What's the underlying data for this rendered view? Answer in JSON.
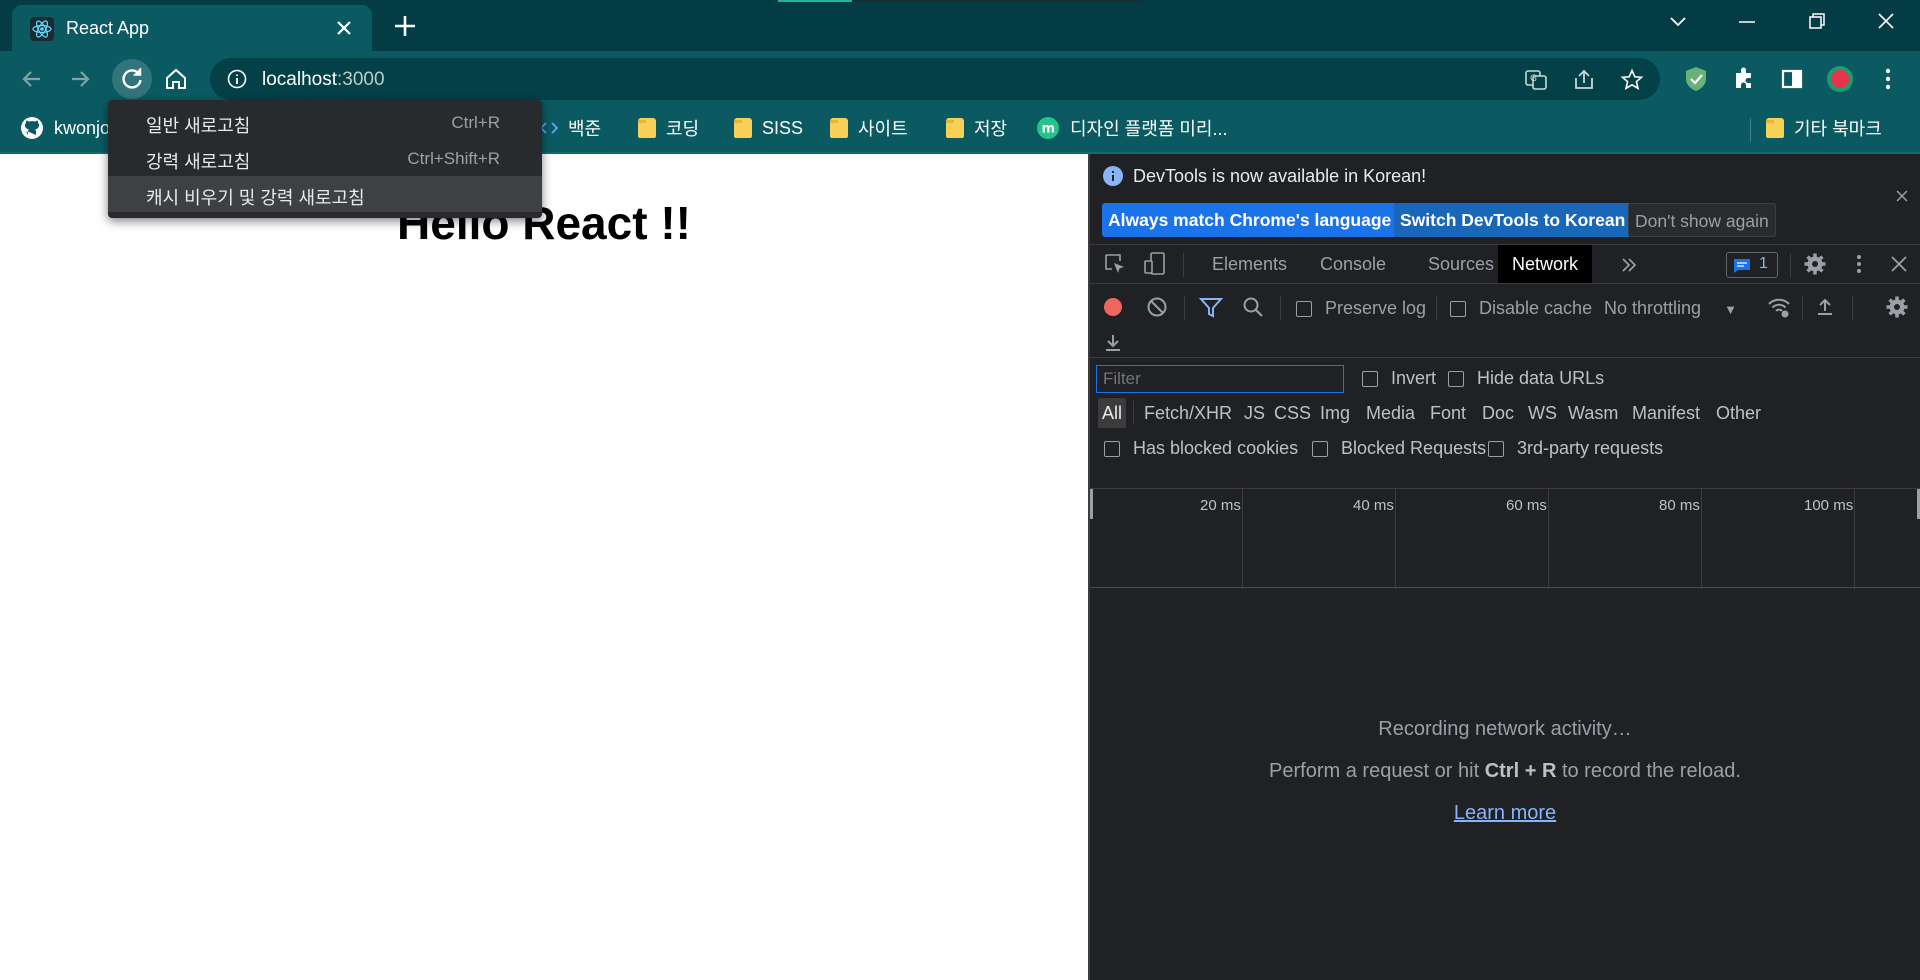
{
  "browser": {
    "tab_title": "React App",
    "url_host": "localhost",
    "url_port": ":3000"
  },
  "bookmarks": [
    {
      "label": "kwonjo",
      "icon": "github-icon"
    },
    {
      "label": "백준",
      "icon": "code-icon"
    },
    {
      "label": "코딩",
      "icon": "folder-icon"
    },
    {
      "label": "SISS",
      "icon": "folder-icon"
    },
    {
      "label": "사이트",
      "icon": "folder-icon"
    },
    {
      "label": "저장",
      "icon": "folder-icon"
    },
    {
      "label": "디자인 플랫폼 미리...",
      "icon": "miro-icon"
    },
    {
      "label": "기타 북마크",
      "icon": "folder-icon"
    }
  ],
  "context_menu": {
    "items": [
      {
        "label": "일반 새로고침",
        "shortcut": "Ctrl+R"
      },
      {
        "label": "강력 새로고침",
        "shortcut": "Ctrl+Shift+R"
      },
      {
        "label": "캐시 비우기 및 강력 새로고침",
        "shortcut": ""
      }
    ]
  },
  "page": {
    "heading": "Hello React !!"
  },
  "devtools": {
    "infobar": {
      "message": "DevTools is now available in Korean!",
      "btn_match": "Always match Chrome's language",
      "btn_switch": "Switch DevTools to Korean",
      "btn_dismiss": "Don't show again"
    },
    "tabs": [
      "Elements",
      "Console",
      "Sources",
      "Network"
    ],
    "active_tab": "Network",
    "issues_count": "1",
    "network": {
      "preserve_log": "Preserve log",
      "disable_cache": "Disable cache",
      "throttling": "No throttling",
      "filter_placeholder": "Filter",
      "invert": "Invert",
      "hide_data_urls": "Hide data URLs",
      "types": [
        "All",
        "Fetch/XHR",
        "JS",
        "CSS",
        "Img",
        "Media",
        "Font",
        "Doc",
        "WS",
        "Wasm",
        "Manifest",
        "Other"
      ],
      "has_blocked_cookies": "Has blocked cookies",
      "blocked_requests": "Blocked Requests",
      "third_party": "3rd-party requests",
      "ticks": [
        "20 ms",
        "40 ms",
        "60 ms",
        "80 ms",
        "100 ms"
      ],
      "empty_line1": "Recording network activity…",
      "empty_line2_a": "Perform a request or hit ",
      "empty_line2_key": "Ctrl + R",
      "empty_line2_b": " to record the reload.",
      "learn_more": "Learn more"
    }
  },
  "colors": {
    "frame": "#033c44",
    "toolbar": "#0b5a62",
    "devtools_bg": "#202124",
    "accent_blue": "#1a73e8"
  }
}
